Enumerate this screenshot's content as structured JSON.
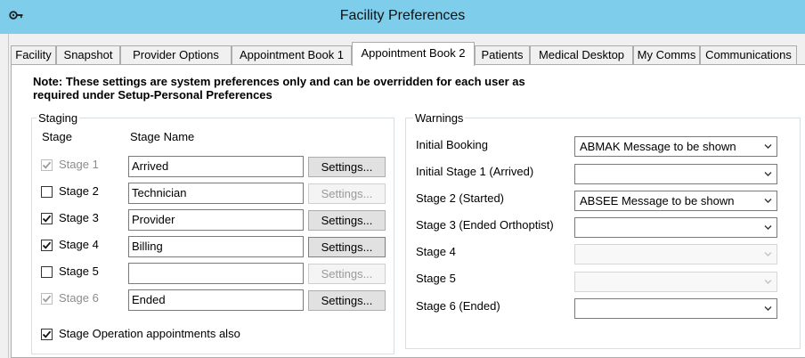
{
  "window": {
    "title": "Facility Preferences"
  },
  "tabs": [
    {
      "label": "Facility",
      "active": false
    },
    {
      "label": "Snapshot",
      "active": false
    },
    {
      "label": "Provider Options",
      "active": false
    },
    {
      "label": "Appointment Book 1",
      "active": false
    },
    {
      "label": "Appointment Book 2",
      "active": true
    },
    {
      "label": "Patients",
      "active": false
    },
    {
      "label": "Medical Desktop",
      "active": false
    },
    {
      "label": "My Comms",
      "active": false
    },
    {
      "label": "Communications",
      "active": false
    }
  ],
  "note": "Note: These settings are system preferences only and can be overridden for each user as required under Setup-Personal Preferences",
  "staging": {
    "title": "Staging",
    "col_stage": "Stage",
    "col_stage_name": "Stage Name",
    "settings_label": "Settings...",
    "rows": [
      {
        "label": "Stage 1",
        "checked": true,
        "enabled": false,
        "name": "Arrived",
        "settings_enabled": true
      },
      {
        "label": "Stage 2",
        "checked": false,
        "enabled": true,
        "name": "Technician",
        "settings_enabled": false
      },
      {
        "label": "Stage 3",
        "checked": true,
        "enabled": true,
        "name": "Provider",
        "settings_enabled": true
      },
      {
        "label": "Stage 4",
        "checked": true,
        "enabled": true,
        "name": "Billing",
        "settings_enabled": true
      },
      {
        "label": "Stage 5",
        "checked": false,
        "enabled": true,
        "name": "",
        "settings_enabled": false
      },
      {
        "label": "Stage 6",
        "checked": true,
        "enabled": false,
        "name": "Ended",
        "settings_enabled": true
      }
    ],
    "operation_checkbox": {
      "label": "Stage Operation appointments also",
      "checked": true
    }
  },
  "warnings": {
    "title": "Warnings",
    "rows": [
      {
        "label": "Initial Booking",
        "value": "ABMAK Message to be shown",
        "enabled": true
      },
      {
        "label": "Initial Stage 1 (Arrived)",
        "value": "",
        "enabled": true
      },
      {
        "label": "Stage 2 (Started)",
        "value": "ABSEE Message to be shown",
        "enabled": true
      },
      {
        "label": "Stage 3 (Ended Orthoptist)",
        "value": "",
        "enabled": true
      },
      {
        "label": "Stage 4",
        "value": "",
        "enabled": false
      },
      {
        "label": "Stage 5",
        "value": "",
        "enabled": false
      },
      {
        "label": "Stage 6 (Ended)",
        "value": "",
        "enabled": true
      }
    ]
  }
}
